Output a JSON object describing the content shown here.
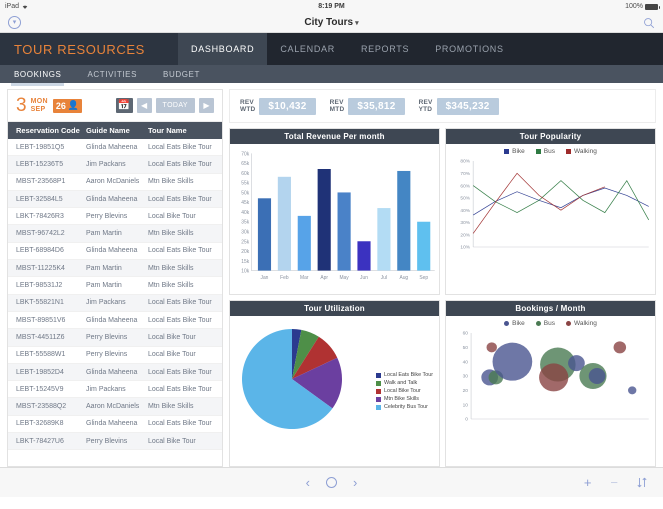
{
  "status_bar": {
    "carrier": "iPad",
    "wifi_icon": "wifi-icon",
    "time": "8:19 PM",
    "battery_percent": "100%"
  },
  "nav_bar": {
    "back_icon": "chevron-down-circle-icon",
    "title": "City Tours",
    "title_caret": "▾",
    "search_icon": "search-icon"
  },
  "app_header": {
    "brand": "TOUR RESOURCES",
    "tabs": [
      {
        "label": "DASHBOARD",
        "active": true
      },
      {
        "label": "CALENDAR",
        "active": false
      },
      {
        "label": "REPORTS",
        "active": false
      },
      {
        "label": "PROMOTIONS",
        "active": false
      }
    ]
  },
  "sub_tabs": [
    {
      "label": "BOOKINGS",
      "active": true
    },
    {
      "label": "ACTIVITIES",
      "active": false
    },
    {
      "label": "BUDGET",
      "active": false
    }
  ],
  "date_bar": {
    "day_number": "3",
    "day_of_week": "MON",
    "month": "SEP",
    "badge_count": "26",
    "badge_icon": "person-icon",
    "calendar_icon": "calendar-icon",
    "prev_icon": "◀",
    "today_label": "TODAY",
    "next_icon": "▶"
  },
  "table": {
    "columns": [
      "Reservation Code",
      "Guide Name",
      "Tour Name"
    ],
    "rows": [
      [
        "LEBT-19851Q5",
        "Glinda Maheena",
        "Local Eats Bike Tour"
      ],
      [
        "LEBT-15236T5",
        "Jim Packans",
        "Local Eats Bike Tour"
      ],
      [
        "MBST-23568P1",
        "Aaron McDaniels",
        "Mtn Bike Skills"
      ],
      [
        "LEBT-32584L5",
        "Glinda Maheena",
        "Local Eats Bike Tour"
      ],
      [
        "LBKT-78426R3",
        "Perry Blevins",
        "Local Bike Tour"
      ],
      [
        "MBST-96742L2",
        "Pam Martin",
        "Mtn Bike Skills"
      ],
      [
        "LEBT-68984D6",
        "Glinda Maheena",
        "Local Eats Bike Tour"
      ],
      [
        "MBST-11225K4",
        "Pam Martin",
        "Mtn Bike Skills"
      ],
      [
        "LEBT-98531J2",
        "Pam Martin",
        "Mtn Bike Skills"
      ],
      [
        "LBKT-55821N1",
        "Jim Packans",
        "Local Eats Bike Tour"
      ],
      [
        "MBST-89851V6",
        "Glinda Maheena",
        "Local Eats Bike Tour"
      ],
      [
        "MBST-44511Z6",
        "Perry Blevins",
        "Local Bike Tour"
      ],
      [
        "LEBT-55588W1",
        "Perry Blevins",
        "Local Bike Tour"
      ],
      [
        "LEBT-19852D4",
        "Glinda Maheena",
        "Local Eats Bike Tour"
      ],
      [
        "LEBT-15245V9",
        "Jim Packans",
        "Local Eats Bike Tour"
      ],
      [
        "MBST-23588Q2",
        "Aaron McDaniels",
        "Mtn Bike Skills"
      ],
      [
        "LEBT-32689K8",
        "Glinda Maheena",
        "Local Eats Bike Tour"
      ],
      [
        "LBKT-78427U6",
        "Perry Blevins",
        "Local Bike Tour"
      ]
    ]
  },
  "kpis": [
    {
      "line1": "REV",
      "line2": "WTD",
      "value": "$10,432"
    },
    {
      "line1": "REV",
      "line2": "MTD",
      "value": "$35,812"
    },
    {
      "line1": "REV",
      "line2": "YTD",
      "value": "$345,232"
    }
  ],
  "chart_data": [
    {
      "type": "bar",
      "title": "Total Revenue Per month",
      "categories": [
        "Jan",
        "Feb",
        "Mar",
        "Apr",
        "May",
        "Jun",
        "Jul",
        "Aug",
        "Sep"
      ],
      "values": [
        47,
        58,
        38,
        62,
        50,
        25,
        42,
        61,
        35
      ],
      "colors": [
        "#3b6fb5",
        "#b3d4ee",
        "#57a3e8",
        "#1f3277",
        "#4a82c8",
        "#3b32c0",
        "#b3dcf4",
        "#4486c4",
        "#5fc0ef"
      ],
      "ylabel": "",
      "xlabel": "",
      "ytick_labels": [
        "70k",
        "65k",
        "60k",
        "55k",
        "50k",
        "45k",
        "40k",
        "35k",
        "30k",
        "25k",
        "20k",
        "15k",
        "10k"
      ],
      "ylim": [
        10,
        70
      ],
      "grid": false
    },
    {
      "type": "line",
      "title": "Tour Popularity",
      "legend": [
        "Bike",
        "Bus",
        "Walking"
      ],
      "legend_colors": [
        "#2b3a8f",
        "#2f7a42",
        "#9e2b2b"
      ],
      "legend_position": "top",
      "x": [
        1,
        2,
        3,
        4,
        5,
        6,
        7,
        8,
        9
      ],
      "ytick_labels": [
        "80%",
        "70%",
        "60%",
        "50%",
        "40%",
        "30%",
        "20%",
        "10%"
      ],
      "ylim": [
        10,
        80
      ],
      "series": [
        {
          "name": "Bike",
          "values": [
            36,
            47,
            55,
            48,
            42,
            52,
            58,
            52,
            43
          ]
        },
        {
          "name": "Bus",
          "values": [
            60,
            47,
            38,
            48,
            64,
            48,
            38,
            64,
            32
          ]
        },
        {
          "name": "Walking",
          "values": [
            21,
            46,
            70,
            52,
            40,
            52,
            59,
            null,
            null
          ]
        }
      ],
      "grid": false
    },
    {
      "type": "pie",
      "title": "Tour Utilization",
      "labels": [
        "Local Eats Bike Tour",
        "Walk and Talk",
        "Local Bike Tour",
        "Mtn Bike Skills",
        "Celebrity Bus Tour"
      ],
      "values": [
        3,
        6,
        9,
        17,
        65
      ],
      "colors": [
        "#2b3a8f",
        "#4e8f48",
        "#b03232",
        "#6b3fa0",
        "#5bb5e8"
      ],
      "legend_position": "right"
    },
    {
      "type": "scatter",
      "title": "Bookings / Month",
      "legend": [
        "Bike",
        "Bus",
        "Walking"
      ],
      "legend_colors": [
        "#4a5590",
        "#4a7a52",
        "#8a4444"
      ],
      "legend_position": "top",
      "ytick_labels": [
        "60",
        "50",
        "40",
        "30",
        "20",
        "10",
        "0"
      ],
      "ylim": [
        0,
        60
      ],
      "points": [
        {
          "series": "Walking",
          "x": 1.0,
          "y": 50,
          "size": 5
        },
        {
          "series": "Bike",
          "x": 0.9,
          "y": 29,
          "size": 8
        },
        {
          "series": "Bus",
          "x": 1.2,
          "y": 29,
          "size": 7
        },
        {
          "series": "Bike",
          "x": 2.0,
          "y": 40,
          "size": 19
        },
        {
          "series": "Bus",
          "x": 4.2,
          "y": 38,
          "size": 17
        },
        {
          "series": "Walking",
          "x": 4.0,
          "y": 29,
          "size": 14
        },
        {
          "series": "Bike",
          "x": 5.1,
          "y": 39,
          "size": 8
        },
        {
          "series": "Bus",
          "x": 5.9,
          "y": 30,
          "size": 13
        },
        {
          "series": "Bike",
          "x": 6.1,
          "y": 30,
          "size": 8
        },
        {
          "series": "Walking",
          "x": 7.2,
          "y": 50,
          "size": 6
        },
        {
          "series": "Bike",
          "x": 7.8,
          "y": 20,
          "size": 4
        }
      ],
      "grid": false
    }
  ],
  "bottom_bar": {
    "prev_icon": "‹",
    "stop_icon": "circle-icon",
    "next_icon": "›",
    "add_icon": "+",
    "minus_icon": "−",
    "sort_icon": "sort-icon"
  }
}
